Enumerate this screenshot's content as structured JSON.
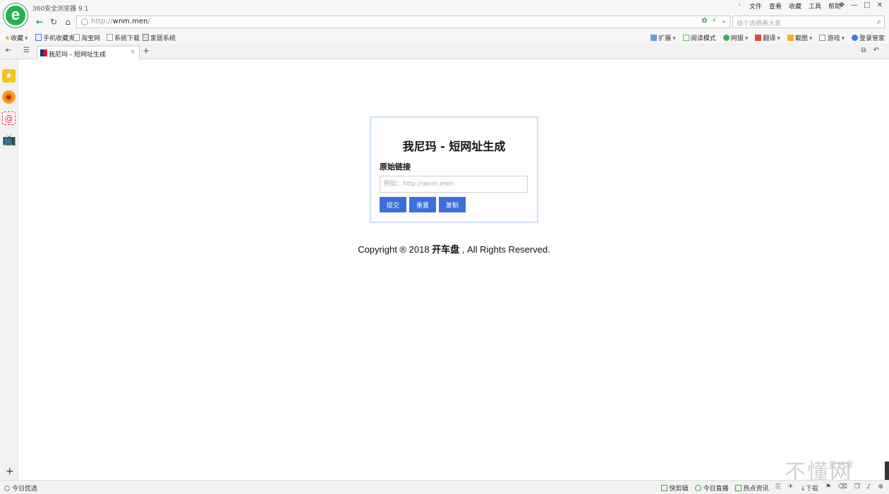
{
  "app": {
    "title": "360安全浏览器 9.1",
    "logo_letter": "e"
  },
  "menu": [
    "文件",
    "查看",
    "收藏",
    "工具",
    "帮助"
  ],
  "window_controls": [
    "❖",
    "—",
    "□",
    "✕"
  ],
  "address": {
    "protocol": "http://",
    "host": "wnm.men",
    "tail": "/"
  },
  "search": {
    "placeholder": "插个肉肠赛大家"
  },
  "bookmarks": {
    "favorites": "收藏",
    "items": [
      "手机收藏夹",
      "淘宝网",
      "系统下载",
      "家居系统"
    ]
  },
  "tools": [
    "扩展",
    "阅读模式",
    "网银",
    "翻译",
    "截图",
    "游戏",
    "登录管家"
  ],
  "tab": {
    "label": "我尼玛 - 短网址生成",
    "close": "×",
    "new": "+"
  },
  "page": {
    "title": "我尼玛 - 短网址生成",
    "field_label": "原始链接",
    "input_placeholder": "例如：http://wnm.men",
    "buttons": {
      "submit": "提交",
      "reset": "重置",
      "copy": "复制"
    },
    "copyright_pre": "Copyright ® 2018",
    "copyright_brand": "开车盘",
    "copyright_post": ", All Rights Reserved."
  },
  "status": {
    "left": "今日优选",
    "right": [
      "快剪辑",
      "今日直播",
      "热点资讯"
    ],
    "download": "下载"
  },
  "watermark": {
    "main": "不懂网",
    "sub": "爱分享"
  }
}
